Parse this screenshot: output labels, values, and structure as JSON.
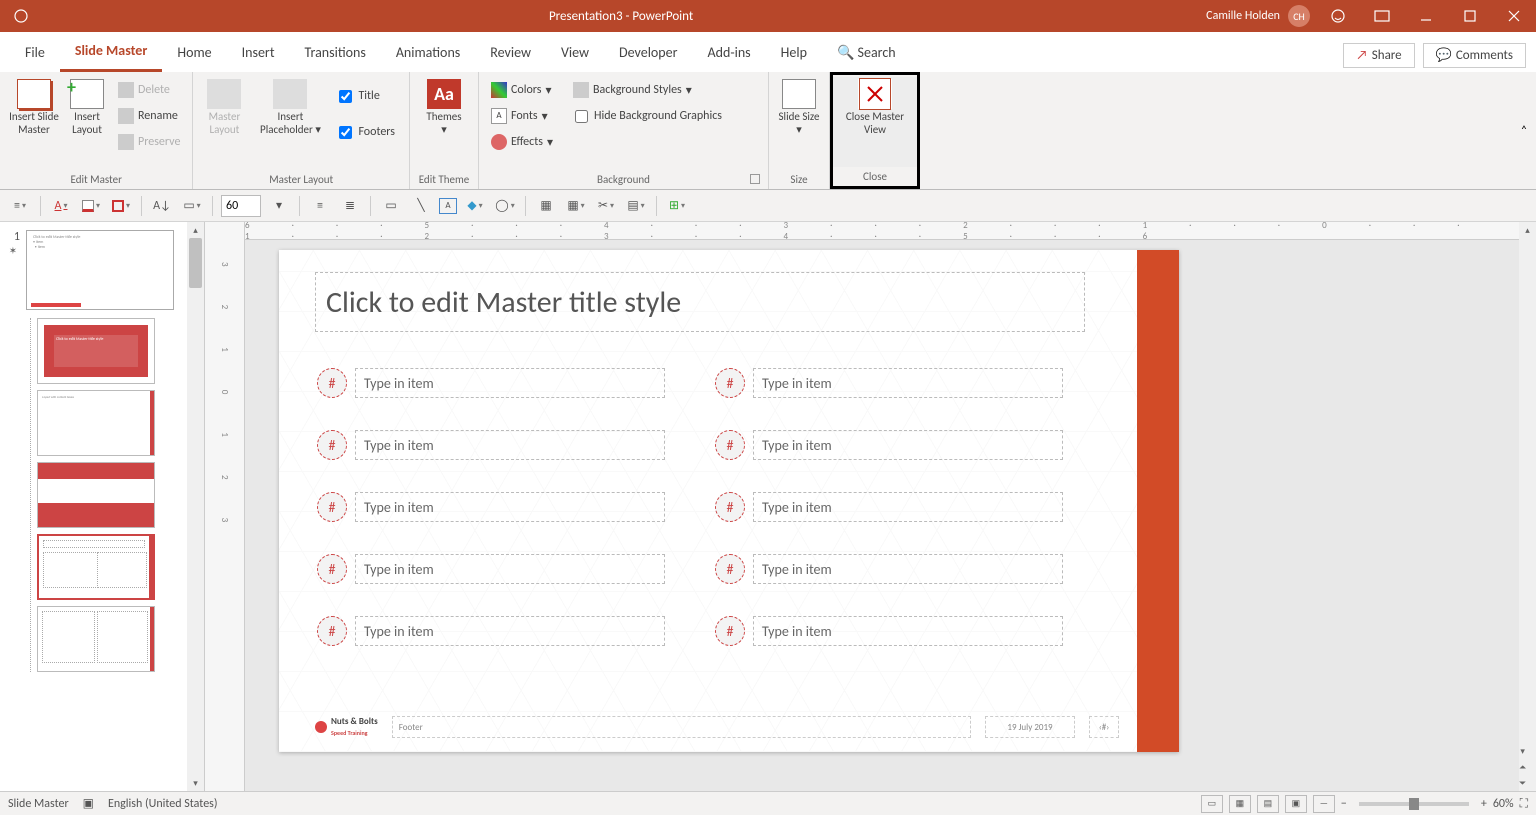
{
  "title": "Presentation3  -  PowerPoint",
  "user": {
    "name": "Camille Holden",
    "initials": "CH"
  },
  "tabs": {
    "file": "File",
    "active": "Slide Master",
    "others": [
      "Home",
      "Insert",
      "Transitions",
      "Animations",
      "Review",
      "View",
      "Developer",
      "Add-ins",
      "Help"
    ],
    "search": "Search",
    "share": "Share",
    "comments": "Comments"
  },
  "ribbon": {
    "edit_master": {
      "insert_slide_master": "Insert Slide Master",
      "insert_layout": "Insert Layout",
      "delete": "Delete",
      "rename": "Rename",
      "preserve": "Preserve",
      "label": "Edit Master"
    },
    "master_layout": {
      "master_layout": "Master Layout",
      "insert_placeholder": "Insert Placeholder",
      "title": "Title",
      "footers": "Footers",
      "label": "Master Layout"
    },
    "edit_theme": {
      "themes": "Themes",
      "label": "Edit Theme"
    },
    "background": {
      "colors": "Colors",
      "fonts": "Fonts",
      "effects": "Effects",
      "bg_styles": "Background Styles",
      "hide_bg": "Hide Background Graphics",
      "label": "Background"
    },
    "size": {
      "slide_size": "Slide Size",
      "label": "Size"
    },
    "close": {
      "btn": "Close Master View",
      "label": "Close"
    }
  },
  "toolbar2": {
    "font_size": "60"
  },
  "thumb": {
    "number": "1"
  },
  "slide": {
    "title_placeholder": "Click to edit Master title style",
    "num_placeholder": "#",
    "item_placeholder": "Type in item",
    "footer_label": "Footer",
    "date": "19 July 2019",
    "logo_main": "Nuts & Bolts",
    "logo_sub": "Speed Training",
    "page_ph": "‹#›"
  },
  "ruler_h": "6 · · · 5 · · · 4 · · · 3 · · · 2 · · · 1 · · · 0 · · · 1 · · · 2 · · · 3 · · · 4 · · · 5 · · · 6",
  "status": {
    "mode": "Slide Master",
    "lang": "English (United States)",
    "zoom": "60%"
  }
}
